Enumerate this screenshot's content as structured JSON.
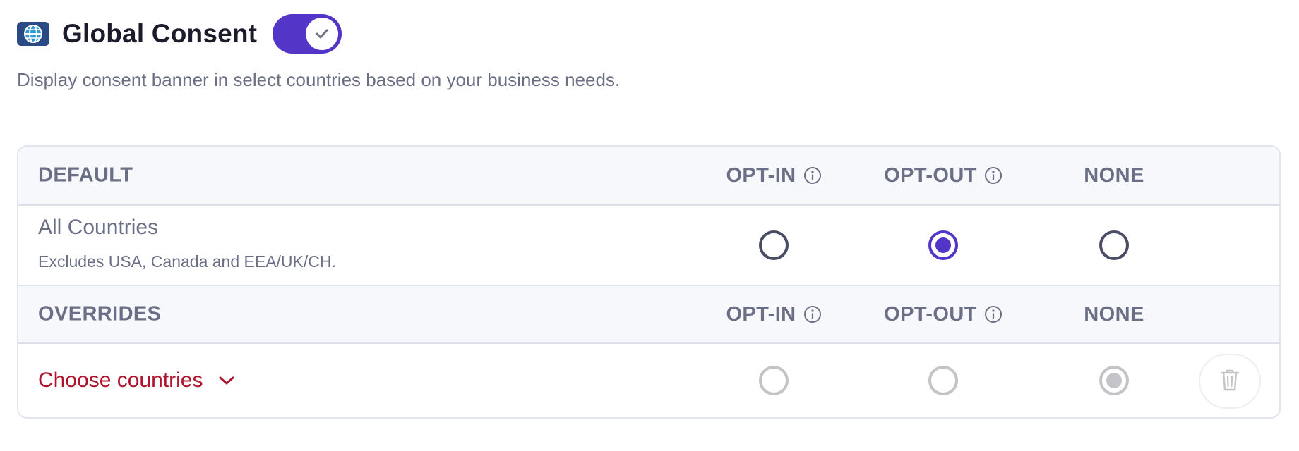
{
  "header": {
    "title": "Global Consent",
    "toggle_on": true,
    "description": "Display consent banner in select countries based on your business needs."
  },
  "table": {
    "default_section": {
      "label": "DEFAULT",
      "columns": [
        "OPT-IN",
        "OPT-OUT",
        "NONE"
      ],
      "row": {
        "title": "All Countries",
        "subtitle": "Excludes USA, Canada and EEA/UK/CH.",
        "selected": "OPT-OUT"
      }
    },
    "overrides_section": {
      "label": "OVERRIDES",
      "columns": [
        "OPT-IN",
        "OPT-OUT",
        "NONE"
      ],
      "row": {
        "select_label": "Choose countries",
        "selected": "NONE",
        "disabled": true
      }
    }
  },
  "icons": {
    "header": "globe-icon",
    "toggle": "check-icon",
    "column_info": "info-icon",
    "dropdown": "chevron-down-icon",
    "delete": "trash-icon"
  },
  "colors": {
    "accent": "#5336c7",
    "danger_text": "#b0142c",
    "muted_text": "#6b6f85",
    "title_text": "#1c1b2c",
    "globe_badge": "#2a4a86"
  }
}
